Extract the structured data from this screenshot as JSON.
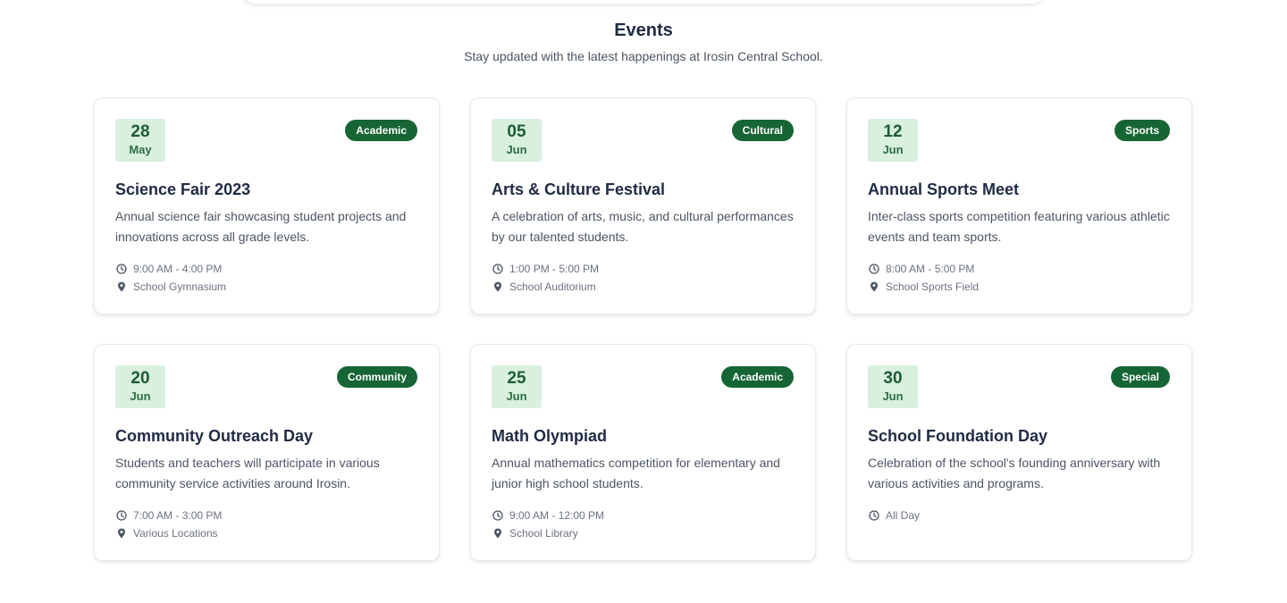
{
  "section": {
    "title": "Events",
    "subtitle": "Stay updated with the latest happenings at Irosin Central School."
  },
  "colors": {
    "badge_bg": "#166534",
    "date_bg": "#d8f0dd",
    "title_text": "#1f2a44"
  },
  "events": [
    {
      "day": "28",
      "month": "May",
      "category": "Academic",
      "title": "Science Fair 2023",
      "description": "Annual science fair showcasing student projects and innovations across all grade levels.",
      "time": "9:00 AM - 4:00 PM",
      "location": "School Gymnasium"
    },
    {
      "day": "05",
      "month": "Jun",
      "category": "Cultural",
      "title": "Arts & Culture Festival",
      "description": "A celebration of arts, music, and cultural performances by our talented students.",
      "time": "1:00 PM - 5:00 PM",
      "location": "School Auditorium"
    },
    {
      "day": "12",
      "month": "Jun",
      "category": "Sports",
      "title": "Annual Sports Meet",
      "description": "Inter-class sports competition featuring various athletic events and team sports.",
      "time": "8:00 AM - 5:00 PM",
      "location": "School Sports Field"
    },
    {
      "day": "20",
      "month": "Jun",
      "category": "Community",
      "title": "Community Outreach Day",
      "description": "Students and teachers will participate in various community service activities around Irosin.",
      "time": "7:00 AM - 3:00 PM",
      "location": "Various Locations"
    },
    {
      "day": "25",
      "month": "Jun",
      "category": "Academic",
      "title": "Math Olympiad",
      "description": "Annual mathematics competition for elementary and junior high school students.",
      "time": "9:00 AM - 12:00 PM",
      "location": "School Library"
    },
    {
      "day": "30",
      "month": "Jun",
      "category": "Special",
      "title": "School Foundation Day",
      "description": "Celebration of the school's founding anniversary with various activities and programs.",
      "time": "All Day"
    }
  ]
}
